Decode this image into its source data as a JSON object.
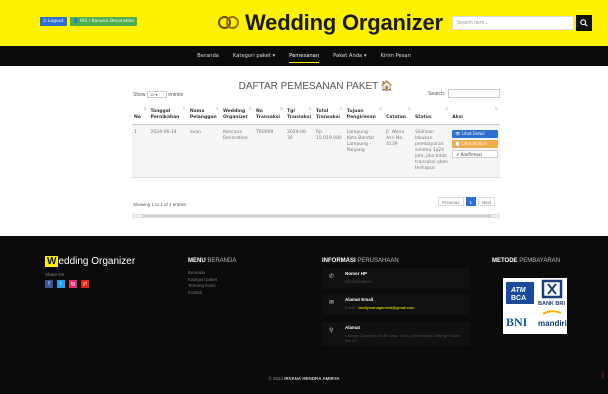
{
  "topbar": {
    "logout_label": "Logout",
    "kasir_label": "IRS / Kasuna Decoration",
    "brand": "Wedding Organizer",
    "search_placeholder": "Search here..."
  },
  "nav": {
    "items": [
      "Beranda",
      "Kategori paket ▾",
      "Pemesanan",
      "Paket Anda ▾",
      "Kirim Pesan"
    ],
    "active": "Pemesanan"
  },
  "main": {
    "heading": "DAFTAR PEMESANAN PAKET",
    "show_label": "Show",
    "show_value": "10",
    "entries_label": "entries",
    "search_label": "Search:",
    "columns": [
      "No",
      "Tanggal Pernikahan",
      "Nama Pelanggan",
      "Wedding Organizer",
      "No Transaksi",
      "Tgl Transaksi",
      "Total Transaksi",
      "Tujuan Pengiriman",
      "Catatan",
      "Status",
      "Aksi"
    ],
    "rows": [
      {
        "no": "1",
        "tanggal": "2024-06-14",
        "nama": "evan",
        "wo": "Kencana Decoration",
        "no_trans": "TR0009",
        "tgl_trans": "2024-06-30",
        "total": "Rp 15.019.000",
        "tujuan": "Lampung - Kota Bandar Lampung - Panjang",
        "catatan": "Jl. Wona Asri No. 4139",
        "status": "Silahkan lakukan pembayaran selama 1x24 jam, jika tidak transaksi akan terhapus",
        "actions": [
          "Lihat Detail",
          "Lihat Invoice",
          "Konfirmasi"
        ]
      }
    ],
    "info": "Showing 1 to 1 of 1 entries",
    "pager": [
      "Previous",
      "1",
      "Next"
    ]
  },
  "footer": {
    "brand_first": "W",
    "brand_rest": "edding Organizer",
    "share_label": "Share On",
    "social": [
      "f",
      "t",
      "ig",
      "yt"
    ],
    "menu_title_b": "MENU",
    "menu_title_rest": "BERANDA",
    "menu_links": [
      "Beranda",
      "Kategori paket",
      "Tentang Kami",
      "Kontak"
    ],
    "info_title_b": "INFORMASI",
    "info_title_rest": "PERUSAHAAN",
    "info_items": [
      {
        "title": "Nomor HP",
        "value": "081393948393"
      },
      {
        "title": "Alamat Email",
        "value_pre": "Email : ",
        "value_hi": "familymanagement@gmail.com"
      },
      {
        "title": "Alamat",
        "value": "Cilacap Cikarang, Kediri Jawa Timur, Kecamatan Duttergi / Kode - Rw 10"
      }
    ],
    "pay_title_b": "METODE",
    "pay_title_rest": "PEMBAYARAN",
    "pay_logos": [
      "ATM BCA",
      "BANK BRI",
      "BNI",
      "mandiri"
    ],
    "copyright_pre": "© 2024 ",
    "copyright_b": "IRVANA HENDRA AMIRYA"
  }
}
